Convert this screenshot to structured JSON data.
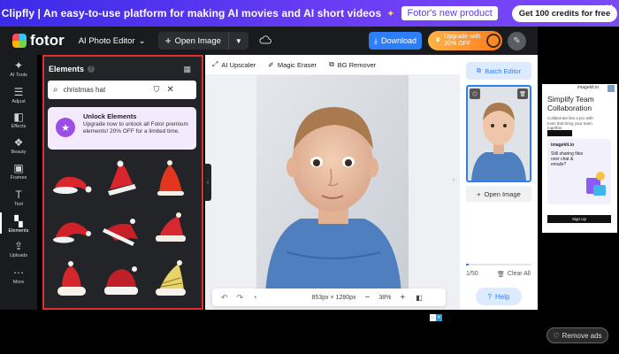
{
  "promo": {
    "text": "Clipfly | An easy-to-use platform for making AI movies and AI short videos",
    "link": "Fotor's new product",
    "cta": "Get 100 credits for free"
  },
  "topbar": {
    "logo": "fotor",
    "editor_label": "AI Photo Editor",
    "open_image": "Open Image",
    "download": "Download",
    "upgrade_line1": "Upgrade with",
    "upgrade_line2": "20% OFF"
  },
  "rail": {
    "items": [
      {
        "label": "AI Tools",
        "icon": "ai-tools-icon"
      },
      {
        "label": "Adjust",
        "icon": "adjust-icon"
      },
      {
        "label": "Effects",
        "icon": "effects-icon"
      },
      {
        "label": "Beauty",
        "icon": "beauty-icon"
      },
      {
        "label": "Frames",
        "icon": "frames-icon"
      },
      {
        "label": "Text",
        "icon": "text-icon"
      },
      {
        "label": "Elements",
        "icon": "elements-icon"
      },
      {
        "label": "Uploads",
        "icon": "uploads-icon"
      },
      {
        "label": "More",
        "icon": "more-icon"
      }
    ],
    "active": "Elements"
  },
  "panel": {
    "title": "Elements",
    "search_value": "christmas hat",
    "unlock_title": "Unlock Elements",
    "unlock_body": "Upgrade now to unlock all Fotor premium elements! 20% OFF for a limited time."
  },
  "toolstrip": {
    "upscaler": "AI Upscaler",
    "eraser": "Magic Eraser",
    "bg_remover": "BG Remover"
  },
  "canvas": {
    "size": "853px × 1280px",
    "zoom": "38%"
  },
  "history": {
    "batch_editor": "Batch Editor",
    "open_image": "Open Image",
    "count": "1/50",
    "clear_all": "Clear All",
    "help": "Help"
  },
  "ad": {
    "brand": "imagekit.io",
    "headline": "Simplify Team Collaboration",
    "body": "Collaborate like a pro with tools that bring your team together.",
    "card_brand": "imagekit.io",
    "card_text": "Still sharing files over chat & emails?",
    "signup": "Sign Up"
  },
  "bottom": {
    "remove_ads": "Remove ads"
  },
  "colors": {
    "accent": "#2d7ff9",
    "panel_highlight": "#e0302e",
    "promo_bg": "#5b3df2"
  }
}
